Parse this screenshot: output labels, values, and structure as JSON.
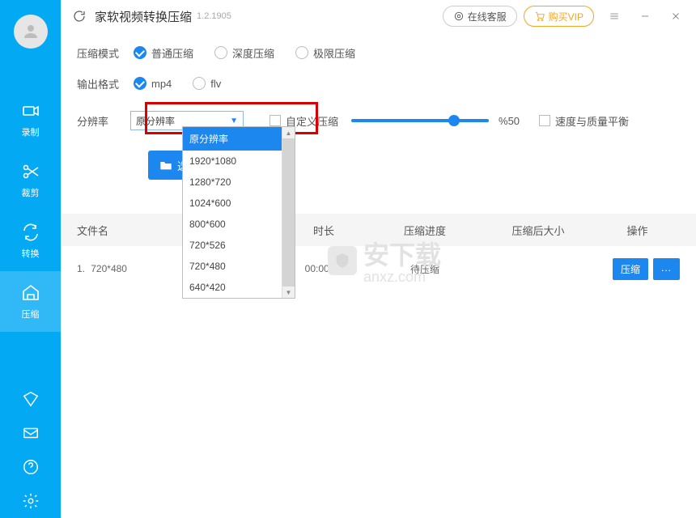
{
  "header": {
    "title": "家软视频转换压缩",
    "version": "1.2.1905",
    "cs_label": "在线客服",
    "vip_label": "购买VIP"
  },
  "sidebar": {
    "items": [
      {
        "label": "录制"
      },
      {
        "label": "裁剪"
      },
      {
        "label": "转换"
      },
      {
        "label": "压缩"
      }
    ]
  },
  "compress_mode": {
    "label": "压缩模式",
    "options": [
      "普通压缩",
      "深度压缩",
      "极限压缩"
    ],
    "selected": "普通压缩"
  },
  "output_format": {
    "label": "输出格式",
    "options": [
      "mp4",
      "flv"
    ],
    "selected": "mp4"
  },
  "resolution": {
    "label": "分辨率",
    "value": "原分辨率",
    "options": [
      "原分辨率",
      "1920*1080",
      "1280*720",
      "1024*600",
      "800*600",
      "720*526",
      "720*480",
      "640*420"
    ]
  },
  "custom_compress": {
    "label": "自定义压缩",
    "checked": false
  },
  "slider": {
    "value": 50,
    "display": "%50"
  },
  "balance": {
    "label": "速度与质量平衡",
    "checked": false
  },
  "select_file_label": "选择",
  "table": {
    "headers": {
      "name": "文件名",
      "duration": "时长",
      "progress": "压缩进度",
      "size": "压缩后大小",
      "op": "操作"
    },
    "rows": [
      {
        "idx": "1.",
        "name": "720*480",
        "duration": "00:00:09",
        "progress": "待压缩",
        "size": ""
      }
    ],
    "compress_btn": "压缩",
    "more_btn": "..."
  },
  "watermark": {
    "line1": "安下载",
    "line2": "anxz.com"
  }
}
